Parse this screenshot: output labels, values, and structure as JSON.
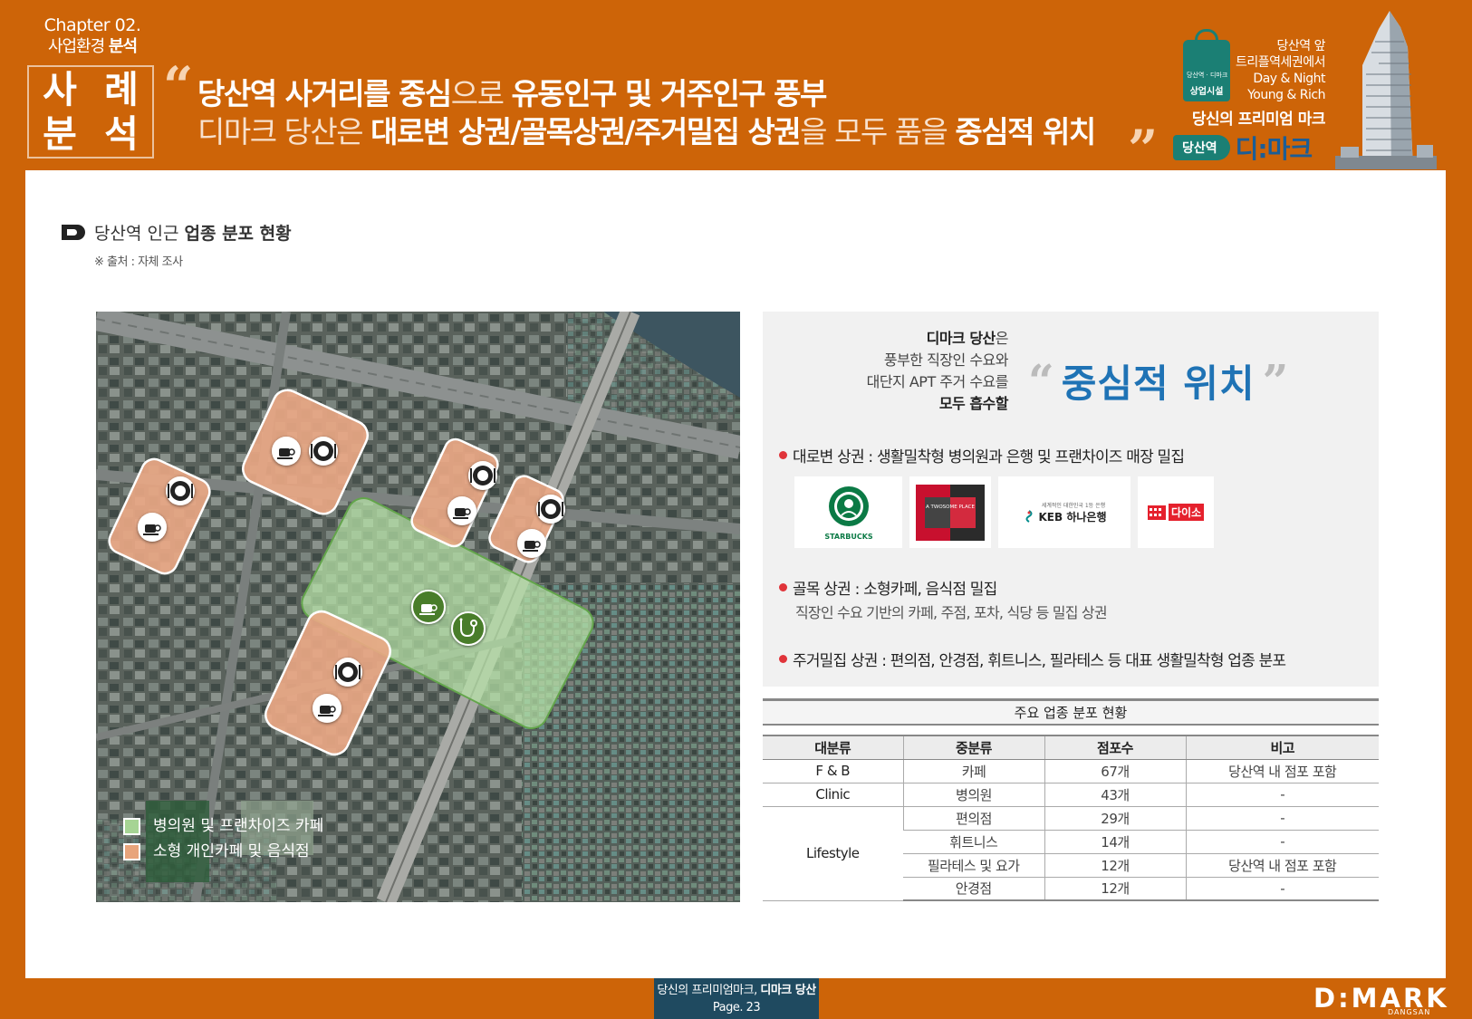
{
  "header": {
    "chapter": "Chapter 02.",
    "section_thin": "사업환경",
    "section_bold": "분석",
    "case_chars": [
      "사",
      "례",
      "분",
      "석"
    ],
    "line1": {
      "p1": "당산역 사거리를 중심",
      "p2": "으로",
      "p3": "유동인구 및 거주인구 풍부"
    },
    "line2": {
      "p1": "디마크 당산은",
      "p2": "대로변 상권/골목상권/주거밀집 상권",
      "p3": "을 모두 품을",
      "p4": "중심적 위치"
    }
  },
  "brand": {
    "bag_label_top": "당산역 · 디마크",
    "bag_label": "상업시설",
    "lines": [
      "당산역 앞",
      "트리플역세권에서",
      "Day & Night",
      "Young & Rich"
    ],
    "tagline": "당신의 프리미엄 마크",
    "pill": "당산역",
    "name": "디:마크"
  },
  "section": {
    "title_thin": "당산역 인근",
    "title_bold": "업종 분포 현황",
    "source": "※ 출처 : 자체 조사"
  },
  "map": {
    "legend": [
      {
        "label": "병의원 및 프랜차이즈 카페",
        "color": "#a6d494"
      },
      {
        "label": "소형 개인카페 및 음식점",
        "color": "#e8a47b"
      }
    ]
  },
  "summary": {
    "intro_bold1": "디마크 당산",
    "intro_1": "은",
    "intro_2": "풍부한 직장인 수요와",
    "intro_3": "대단지 APT 주거 수요를",
    "intro_bold4": "모두 흡수할",
    "focus": "중심적 위치",
    "bullets": [
      "대로변 상권 : 생활밀착형 병의원과 은행 및 프랜차이즈 매장 밀집",
      "골목 상권 : 소형카페, 음식점 밀집",
      "주거밀집 상권 : 편의점, 안경점, 휘트니스, 필라테스 등 대표 생활밀착형 업종 분포"
    ],
    "sub": "직장인 수요 기반의 카페, 주점, 포차, 식당 등 밀집 상권",
    "logos": {
      "starbucks": "STARBUCKS",
      "twosome": "A TWOSOME PLACE",
      "keb": "KEB 하나은행",
      "keb_small": "세계적인 대한민국 1등 은행",
      "daiso": "다이소"
    },
    "colors": {
      "accent": "#1f73b5",
      "bullet": "#e0343a",
      "brand": "#cd6408"
    }
  },
  "table": {
    "title": "주요 업종 분포 현황",
    "headers": [
      "대분류",
      "중분류",
      "점포수",
      "비고"
    ],
    "rows": [
      {
        "cat": "F & B",
        "sub": "카페",
        "count": "67개",
        "note": "당산역 내 점포 포함"
      },
      {
        "cat": "Clinic",
        "sub": "병의원",
        "count": "43개",
        "note": "-"
      },
      {
        "cat": "Lifestyle",
        "sub": "편의점",
        "count": "29개",
        "note": "-"
      },
      {
        "cat": "",
        "sub": "휘트니스",
        "count": "14개",
        "note": "-"
      },
      {
        "cat": "",
        "sub": "필라테스 및 요가",
        "count": "12개",
        "note": "당산역 내 점포 포함"
      },
      {
        "cat": "",
        "sub": "안경점",
        "count": "12개",
        "note": "-"
      }
    ]
  },
  "footer": {
    "line1_thin": "당신의 프리미엄마크,",
    "line1_bold": "디마크 당산",
    "page": "Page. 23",
    "logo": "D:MARK",
    "logo_sub": "DANGSAN"
  }
}
